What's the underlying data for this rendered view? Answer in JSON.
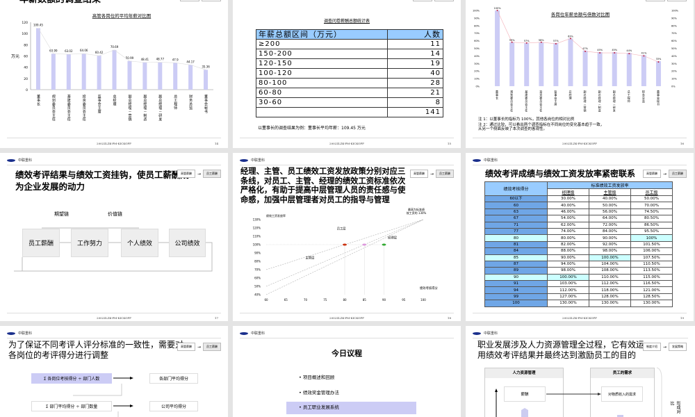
{
  "common": {
    "logo_text": "中联重科",
    "footer": "2002ZLZK-PM-KICKOFF",
    "nav_from": "高管薪酬",
    "nav_to": "员工薪酬",
    "nav_arrow": "→"
  },
  "slide14": {
    "title": "年薪数额的调查结果",
    "page": "14",
    "chart_data": {
      "type": "bar",
      "title": "高管各岗位的平均年薪对比图",
      "ylabel": "万元",
      "ylim": [
        0,
        120
      ],
      "yticks": [
        0,
        20,
        40,
        60,
        80,
        100,
        120
      ],
      "categories": [
        "董事长",
        "规划委员会主任",
        "基建委员会主任",
        "投资委员会主任",
        "监事会主席",
        "总经理",
        "副总经理－营销",
        "副总经理－制造",
        "副总经理－研发",
        "总工程师",
        "财务总监",
        "董事会秘书"
      ],
      "values": [
        109.45,
        63.99,
        63.02,
        64.06,
        60.42,
        70.69,
        50.99,
        48.41,
        48.77,
        47.9,
        44.17,
        35.36
      ],
      "value_labels": [
        "109.45",
        "63.99",
        "63.02",
        "64.06",
        "60.42",
        "70.69",
        "50.99",
        "48.41",
        "48.77",
        "47.9",
        "44.17",
        "35.36"
      ]
    }
  },
  "slide15": {
    "page": "15",
    "table_title": "调查问卷薪酬总额统计表",
    "headers": [
      "年薪总额区间（万元）",
      "人数"
    ],
    "rows": [
      [
        "≥200",
        "11"
      ],
      [
        "150-200",
        "14"
      ],
      [
        "120-150",
        "19"
      ],
      [
        "100-120",
        "40"
      ],
      [
        "80-100",
        "28"
      ],
      [
        "60-80",
        "21"
      ],
      [
        "30-60",
        "8"
      ],
      [
        "",
        "141"
      ]
    ],
    "note": "以董事长的调查结果为例：董事长平均年薪：109.45 万元"
  },
  "slide16": {
    "page": "16",
    "chart_data": {
      "type": "bar",
      "title": "各岗位年薪总额与倍数对比图",
      "ylim": [
        0,
        100
      ],
      "yticks": [
        "0%",
        "10%",
        "20%",
        "30%",
        "40%",
        "50%",
        "60%",
        "70%",
        "80%",
        "90%",
        "100%"
      ],
      "categories": [
        "董事长",
        "规划委员会主任",
        "基建委员会主任",
        "投资委员会主任",
        "监事会主席",
        "总经理",
        "副总经理－营销",
        "副总经理－制造",
        "副总经理－研发",
        "总工程师",
        "财务总监",
        "董事会秘书"
      ],
      "values": [
        100,
        58,
        57,
        58,
        57,
        63,
        47,
        45,
        45,
        44,
        41,
        33
      ],
      "line_values": [
        100,
        58,
        57,
        58,
        56,
        63,
        46,
        44,
        44,
        43,
        40,
        32
      ],
      "value_labels": [
        "100%",
        "58%",
        "57%",
        "58%",
        "57%",
        "63%",
        "47%",
        "45%",
        "45%",
        "44%",
        "41%",
        "33%"
      ]
    },
    "note1": "注 1：以董事长的指标为 100%，其他各岗位的相对比例",
    "note2a": "注 2：通过比较，可以看出两个调查指标在不同岗位的变化基本趋于一致，",
    "note2b": "从另一个侧面反映了本次调查的客观性。"
  },
  "slide17": {
    "page": "17",
    "title1": "绩效考评结果与绩效工资挂钩，使员工薪酬成",
    "title2": "为企业发展的动力",
    "chain1": "期望链",
    "chain2": "价值链",
    "boxes": [
      "员工薪酬",
      "工作努力",
      "个人绩效",
      "公司绩效"
    ]
  },
  "slide18": {
    "page": "18",
    "title": [
      "经理、主管、员工绩效工资发放政策分别对应三",
      "条线，对员工、主管、经理的绩效工资标准依次",
      "严格化，有助于提高中层管理人员的责任感与使",
      "命感，加强中层管理者对员工的指导与管理"
    ],
    "chart_data": {
      "type": "line",
      "ylabel": "绩效工资发放率",
      "xlabel": "绩效考核得分",
      "xlim": [
        60,
        100
      ],
      "ylim": [
        40,
        130
      ],
      "xticks": [
        "60",
        "65",
        "70",
        "75",
        "80",
        "85",
        "90",
        "95",
        "100"
      ],
      "yticks": [
        "40%",
        "50%",
        "60%",
        "70%",
        "80%",
        "90%",
        "100%",
        "110%",
        "120%",
        "130%"
      ],
      "series": [
        {
          "name": "员工层",
          "x": [
            60,
            100
          ],
          "y": [
            70,
            130
          ],
          "point": [
            80,
            100
          ],
          "color": "#cc3311"
        },
        {
          "name": "主管层",
          "x": [
            60,
            100
          ],
          "y": [
            50,
            130
          ],
          "point": [
            85,
            100
          ],
          "color": "#dd99dd"
        },
        {
          "name": "经理层",
          "x": [
            60,
            100
          ],
          "y": [
            40,
            130
          ],
          "point": [
            90,
            100
          ],
          "color": "#33aa33"
        }
      ],
      "annotation": [
        "最高为标准绩",
        "效工资的 130%"
      ]
    }
  },
  "slide19": {
    "page": "19",
    "title": "绩效考评成绩与绩效工资发放率紧密联系",
    "h_score": "绩效考核得分",
    "h_group": "标准绩效工资发放率",
    "h_cols": [
      "经理级",
      "主管级",
      "员工级"
    ],
    "rows": [
      [
        "60以下",
        "30.00%",
        "40.00%",
        "50.00%"
      ],
      [
        "60",
        "40.00%",
        "50.00%",
        "70.00%"
      ],
      [
        "63",
        "46.00%",
        "56.00%",
        "74.50%"
      ],
      [
        "67",
        "54.00%",
        "64.00%",
        "80.50%"
      ],
      [
        "71",
        "62.00%",
        "72.00%",
        "86.50%"
      ],
      [
        "77",
        "74.00%",
        "84.00%",
        "95.50%"
      ],
      [
        "80",
        "80.00%",
        "90.00%",
        "100%"
      ],
      [
        "81",
        "82.00%",
        "92.00%",
        "101.50%"
      ],
      [
        "84",
        "88.00%",
        "98.00%",
        "106.00%"
      ],
      [
        "85",
        "90.00%",
        "100.00%",
        "107.50%"
      ],
      [
        "87",
        "94.00%",
        "104.00%",
        "110.50%"
      ],
      [
        "89",
        "98.00%",
        "108.00%",
        "113.50%"
      ],
      [
        "90",
        "100.00%",
        "110.00%",
        "115.00%"
      ],
      [
        "91",
        "103.00%",
        "112.00%",
        "116.50%"
      ],
      [
        "94",
        "112.00%",
        "118.00%",
        "121.00%"
      ],
      [
        "99",
        "127.00%",
        "128.00%",
        "128.50%"
      ],
      [
        "100",
        "130.00%",
        "130.00%",
        "130.00%"
      ]
    ],
    "highlight": {
      "80": [
        0,
        3
      ],
      "85": [
        0,
        2
      ],
      "90": [
        0,
        1
      ]
    }
  },
  "slide20": {
    "title1": "为了保证不同考评人评分标准的一致性，需要对",
    "title2": "各岗位的考评得分进行调整",
    "f1": "Σ 各岗位考核得分 ÷ 部门人数",
    "r1": "各部门平均得分",
    "f2": "Σ 部门平均得分 ÷ 部门数量",
    "r2": "公司平均得分"
  },
  "slide21": {
    "title": "今日议程",
    "items": [
      "项目概述和回顾",
      "绩效奖金管理办法",
      "员工职业发展系统"
    ]
  },
  "slide22": {
    "title1": "职业发展涉及人力资源管理全过程，它有效运",
    "title2": "用绩效考评结果并最终达到激励员工的目的",
    "nav_from": "制度介绍",
    "nav_to": "发展策略",
    "col1": "人力资源管理",
    "col2": "员工的需求",
    "item1": "薪酬",
    "need1": "对物质收入的需求",
    "side": "形成对比"
  }
}
